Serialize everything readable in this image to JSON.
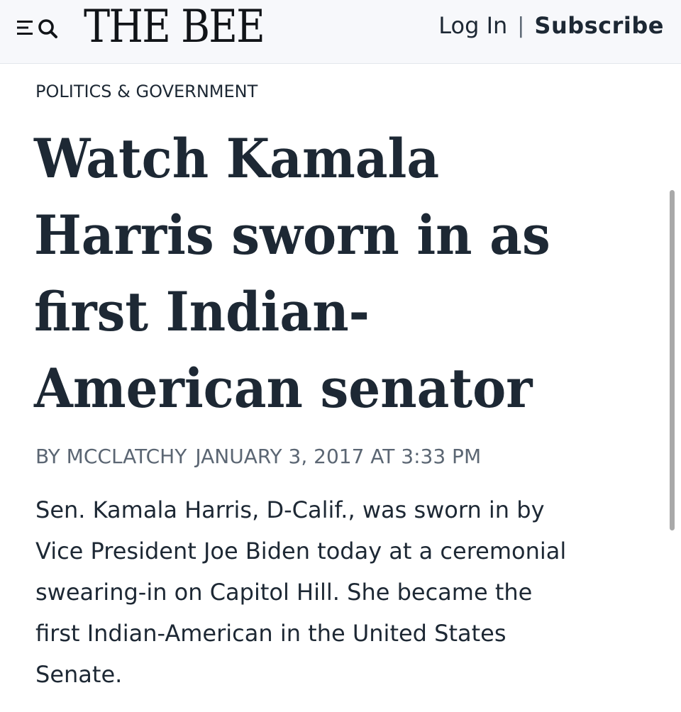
{
  "header": {
    "logo": "THE BEE",
    "login_label": "Log In",
    "separator": "|",
    "subscribe_label": "Subscribe",
    "menu_icon": "hamburger-icon",
    "search_icon": "search-icon"
  },
  "article": {
    "section": "POLITICS & GOVERNMENT",
    "headline_lines": [
      "Watch Kamala",
      "Harris sworn in as",
      "first Indian-",
      "American senator"
    ],
    "byline": "BY MCCLATCHY",
    "dateline": "JANUARY 3, 2017 AT 3:33 PM",
    "body_lines": [
      "Sen. Kamala Harris, D-Calif., was sworn in by",
      "Vice President Joe Biden today at a ceremonial",
      "swearing-in on Capitol Hill. She became the",
      "first Indian-American in the United States",
      "Senate."
    ]
  },
  "colors": {
    "header_bg": "#f7f8fb",
    "text": "#1d2834",
    "meta_text": "#5b6673",
    "scrollbar": "#a9a9a9"
  }
}
